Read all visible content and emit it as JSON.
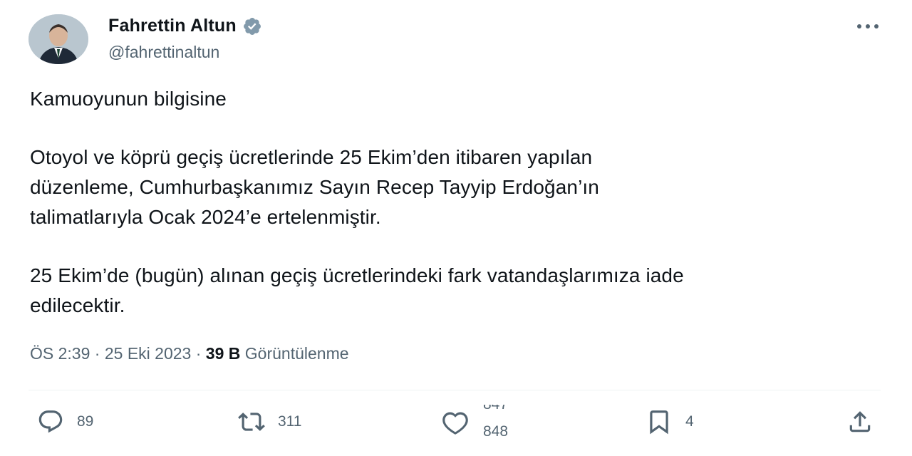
{
  "author": {
    "name": "Fahrettin Altun",
    "handle": "@fahrettinaltun",
    "verified_color": "#829aab"
  },
  "tweet": {
    "lines": [
      "Kamuoyunun bilgisine",
      "Otoyol ve köprü geçiş ücretlerinde 25 Ekim’den itibaren yapılan",
      "düzenleme, Cumhurbaşkanımız Sayın Recep Tayyip Erdoğan’ın",
      "talimatlarıyla Ocak 2024’e ertelenmiştir.",
      "25 Ekim’de (bugün) alınan geçiş ücretlerindeki fark vatandaşlarımıza iade",
      "edilecektir."
    ]
  },
  "meta": {
    "time": "ÖS 2:39",
    "separator": "·",
    "date": "25 Eki 2023",
    "views_count": "39 B",
    "views_label": "Görüntülenme"
  },
  "actions": {
    "reply_count": "89",
    "repost_count": "311",
    "like_count_old": "847",
    "like_count": "848",
    "bookmark_count": "4"
  },
  "colors": {
    "text": "#0f1419",
    "secondary": "#536471",
    "divider": "#eff3f4"
  }
}
